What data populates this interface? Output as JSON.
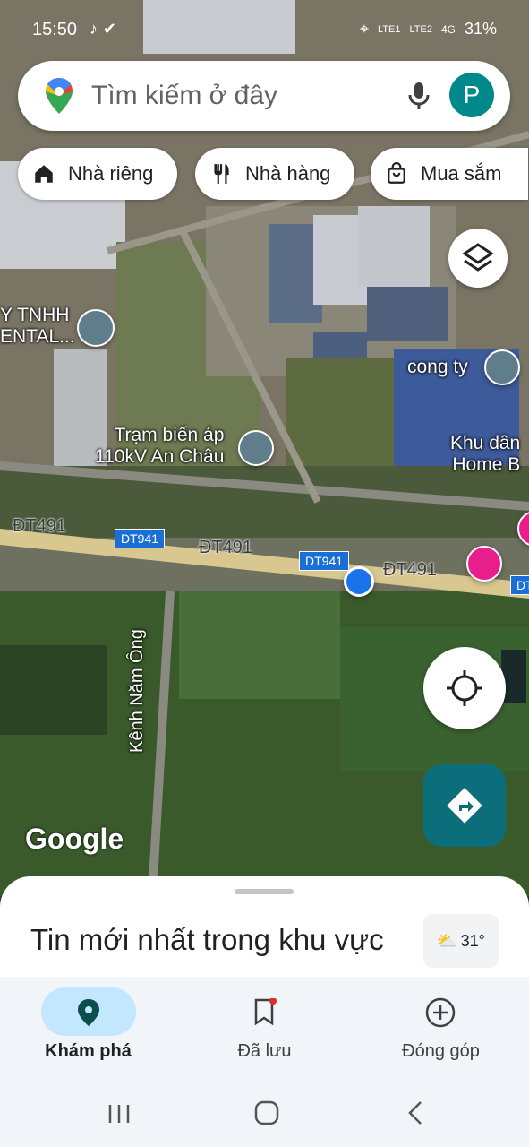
{
  "status_bar": {
    "time": "15:50",
    "battery": "31%",
    "sim1": "LTE1",
    "sim2": "LTE2",
    "network": "4G"
  },
  "search": {
    "placeholder": "Tìm kiếm ở đây",
    "avatar_letter": "P"
  },
  "chips": [
    {
      "label": "Nhà riêng",
      "icon": "home-icon"
    },
    {
      "label": "Nhà hàng",
      "icon": "restaurant-icon"
    },
    {
      "label": "Mua sắm",
      "icon": "shopping-bag-icon"
    }
  ],
  "map_labels": {
    "company_left": "Y TNHH\nENTAL...",
    "company_right": "cong ty",
    "substation": "Trạm biến áp\n110kV An Châu",
    "residential": "Khu dân\nHome B",
    "road_dt491_a": "ĐT491",
    "road_dt491_b": "ĐT491",
    "road_dt491_c": "ĐT491",
    "badge_dt941_a": "DT941",
    "badge_dt941_b": "DT941",
    "badge_dt_right": "DT",
    "canal": "Kênh Năm Ông",
    "google_logo": "Google"
  },
  "sheet": {
    "title": "Tin mới nhất trong khu vực",
    "temperature": "31°"
  },
  "bottom_nav": [
    {
      "label": "Khám phá",
      "icon": "explore-pin-icon",
      "active": true
    },
    {
      "label": "Đã lưu",
      "icon": "bookmark-icon",
      "active": false
    },
    {
      "label": "Đóng góp",
      "icon": "add-circle-icon",
      "active": false
    }
  ],
  "colors": {
    "accent": "#0b6e7a",
    "active_pill": "#c2e7ff",
    "pin_blue": "#1a73e8"
  }
}
